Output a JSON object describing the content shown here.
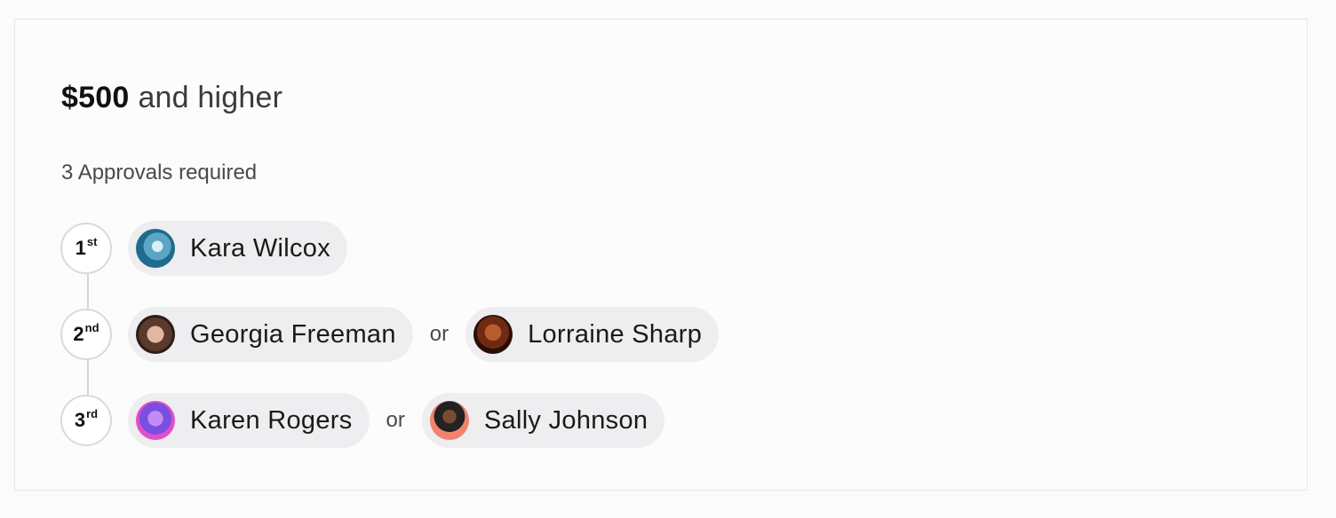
{
  "rule": {
    "amount": "$500",
    "amount_suffix": "and higher",
    "approvals_text": "3 Approvals required"
  },
  "steps": [
    {
      "number": "1",
      "suffix": "st",
      "approvers": [
        {
          "name": "Kara Wilcox",
          "avatar": "kara-avatar"
        }
      ]
    },
    {
      "number": "2",
      "suffix": "nd",
      "separator": "or",
      "approvers": [
        {
          "name": "Georgia Freeman",
          "avatar": "georgia-avatar"
        },
        {
          "name": "Lorraine Sharp",
          "avatar": "lorraine-avatar"
        }
      ]
    },
    {
      "number": "3",
      "suffix": "rd",
      "separator": "or",
      "approvers": [
        {
          "name": "Karen Rogers",
          "avatar": "karen-avatar"
        },
        {
          "name": "Sally Johnson",
          "avatar": "sally-avatar"
        }
      ]
    }
  ],
  "colors": {
    "pill_background": "#eeedf0",
    "border": "#e6e6e8",
    "badge_border": "#dadadc",
    "text": "#1a1a1a"
  }
}
